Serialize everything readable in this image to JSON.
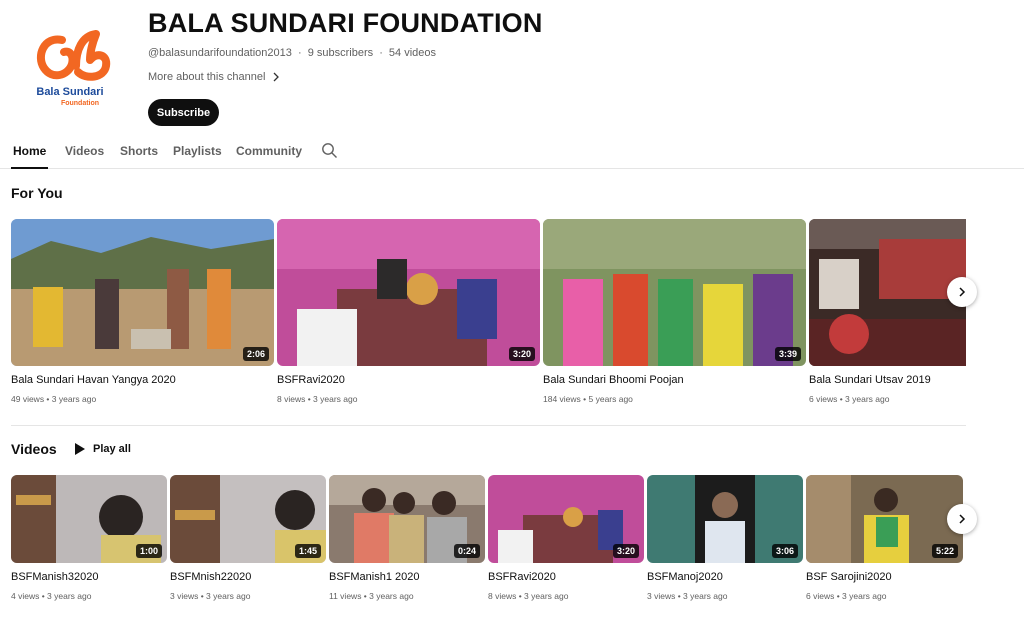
{
  "channel": {
    "logo_text": "Bala Sundari",
    "logo_subtext": "Foundation",
    "title": "BALA SUNDARI FOUNDATION",
    "handle": "@balasundarifoundation2013",
    "subscribers": "9 subscribers",
    "videos_count": "54 videos",
    "separator": "·",
    "more_label": "More about this channel",
    "subscribe_label": "Subscribe"
  },
  "tabs": [
    {
      "label": "Home"
    },
    {
      "label": "Videos"
    },
    {
      "label": "Shorts"
    },
    {
      "label": "Playlists"
    },
    {
      "label": "Community"
    }
  ],
  "for_you": {
    "title": "For You",
    "items": [
      {
        "title": "Bala Sundari Havan Yangya 2020",
        "meta": "49 views • 3 years ago",
        "duration": "2:06"
      },
      {
        "title": "BSFRavi2020",
        "meta": "8 views • 3 years ago",
        "duration": "3:20"
      },
      {
        "title": "Bala Sundari Bhoomi Poojan",
        "meta": "184 views • 5 years ago",
        "duration": "3:39"
      },
      {
        "title": "Bala Sundari Utsav 2019",
        "meta": "6 views • 3 years ago",
        "duration": ""
      }
    ]
  },
  "videos": {
    "title": "Videos",
    "play_all_label": "Play all",
    "items": [
      {
        "title": "BSFManish32020",
        "meta": "4 views • 3 years ago",
        "duration": "1:00"
      },
      {
        "title": "BSFMnish22020",
        "meta": "3 views • 3 years ago",
        "duration": "1:45"
      },
      {
        "title": "BSFManish1 2020",
        "meta": "11 views • 3 years ago",
        "duration": "0:24"
      },
      {
        "title": "BSFRavi2020",
        "meta": "8 views • 3 years ago",
        "duration": "3:20"
      },
      {
        "title": "BSFManoj2020",
        "meta": "3 views • 3 years ago",
        "duration": "3:06"
      },
      {
        "title": "BSF Sarojini2020",
        "meta": "6 views • 3 years ago",
        "duration": "5:22"
      }
    ]
  },
  "colors": {
    "brand_orange": "#f26722",
    "brand_blue": "#1d4b9b",
    "text_primary": "#0f0f0f",
    "text_secondary": "#606060"
  },
  "icons": {
    "search": "search-icon",
    "chevron": "chevron-right-icon",
    "play": "play-icon"
  }
}
